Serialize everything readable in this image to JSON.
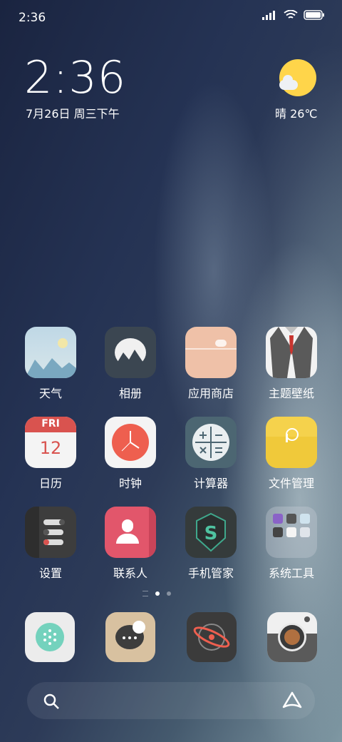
{
  "status": {
    "time": "2:36",
    "icons": [
      "signal-icon",
      "wifi-icon",
      "battery-icon"
    ]
  },
  "clock_widget": {
    "time": "2:36",
    "date": "7月26日 周三下午"
  },
  "weather_widget": {
    "condition": "晴",
    "temp": "26℃",
    "icon": "sunny-cloud-icon"
  },
  "apps": [
    {
      "label": "天气",
      "icon": "weather-icon"
    },
    {
      "label": "相册",
      "icon": "gallery-icon"
    },
    {
      "label": "应用商店",
      "icon": "app-store-icon"
    },
    {
      "label": "主题壁纸",
      "icon": "themes-icon"
    },
    {
      "label": "日历",
      "icon": "calendar-icon",
      "day": "FRI",
      "date": "12"
    },
    {
      "label": "时钟",
      "icon": "clock-icon"
    },
    {
      "label": "计算器",
      "icon": "calculator-icon"
    },
    {
      "label": "文件管理",
      "icon": "file-manager-icon"
    },
    {
      "label": "设置",
      "icon": "settings-icon"
    },
    {
      "label": "联系人",
      "icon": "contacts-icon"
    },
    {
      "label": "手机管家",
      "icon": "security-icon"
    },
    {
      "label": "系统工具",
      "icon": "tools-folder-icon"
    }
  ],
  "page_indicator": {
    "pages": 2,
    "current": 1
  },
  "dock": [
    {
      "icon": "phone-icon"
    },
    {
      "icon": "messages-icon"
    },
    {
      "icon": "browser-icon"
    },
    {
      "icon": "camera-icon"
    }
  ],
  "search_bar": {
    "left_icon": "search-icon",
    "right_icon": "assistant-icon"
  }
}
